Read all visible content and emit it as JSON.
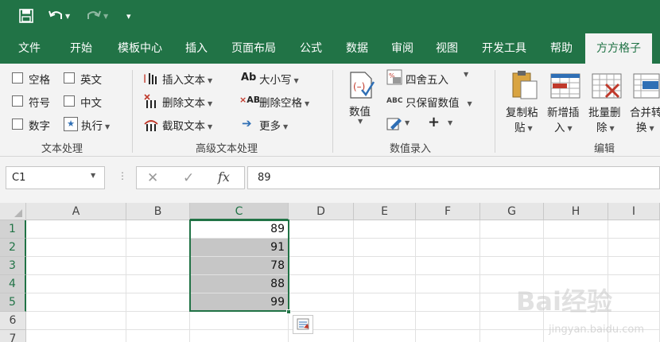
{
  "tabs": [
    "文件",
    "开始",
    "模板中心",
    "插入",
    "页面布局",
    "公式",
    "数据",
    "审阅",
    "视图",
    "开发工具",
    "帮助",
    "方方格子"
  ],
  "ribbon": {
    "text_group": {
      "label": "文本处理",
      "checks": [
        "空格",
        "英文",
        "符号",
        "中文",
        "数字"
      ],
      "execute": "执行"
    },
    "advanced_group": {
      "label": "高级文本处理",
      "insert_text": "插入文本",
      "delete_text": "删除文本",
      "extract_text": "截取文本",
      "case": "大小写",
      "delete_space": "删除空格",
      "more": "更多"
    },
    "numeric_group": {
      "label": "数值录入",
      "value": "数值",
      "round": "四舍五入",
      "keep_value": "只保留数值"
    },
    "edit_group": {
      "label": "编辑",
      "copy_paste_1": "复制粘",
      "copy_paste_2": "贴",
      "new_insert_1": "新增插",
      "new_insert_2": "入",
      "batch_delete_1": "批量删",
      "batch_delete_2": "除",
      "merge_1": "合并转",
      "merge_2": "换"
    }
  },
  "formula_bar": {
    "name_box": "C1",
    "value": "89",
    "fx": "fx"
  },
  "columns": [
    "A",
    "B",
    "C",
    "D",
    "E",
    "F",
    "G",
    "H",
    "I"
  ],
  "rows": [
    "1",
    "2",
    "3",
    "4",
    "5",
    "6",
    "7"
  ],
  "cells_c": [
    "89",
    "91",
    "78",
    "88",
    "99"
  ],
  "watermark": {
    "main": "Bai经验",
    "sub": "jingyan.baidu.com"
  },
  "colors": {
    "accent": "#217346",
    "selection": "#c6c6c6"
  }
}
